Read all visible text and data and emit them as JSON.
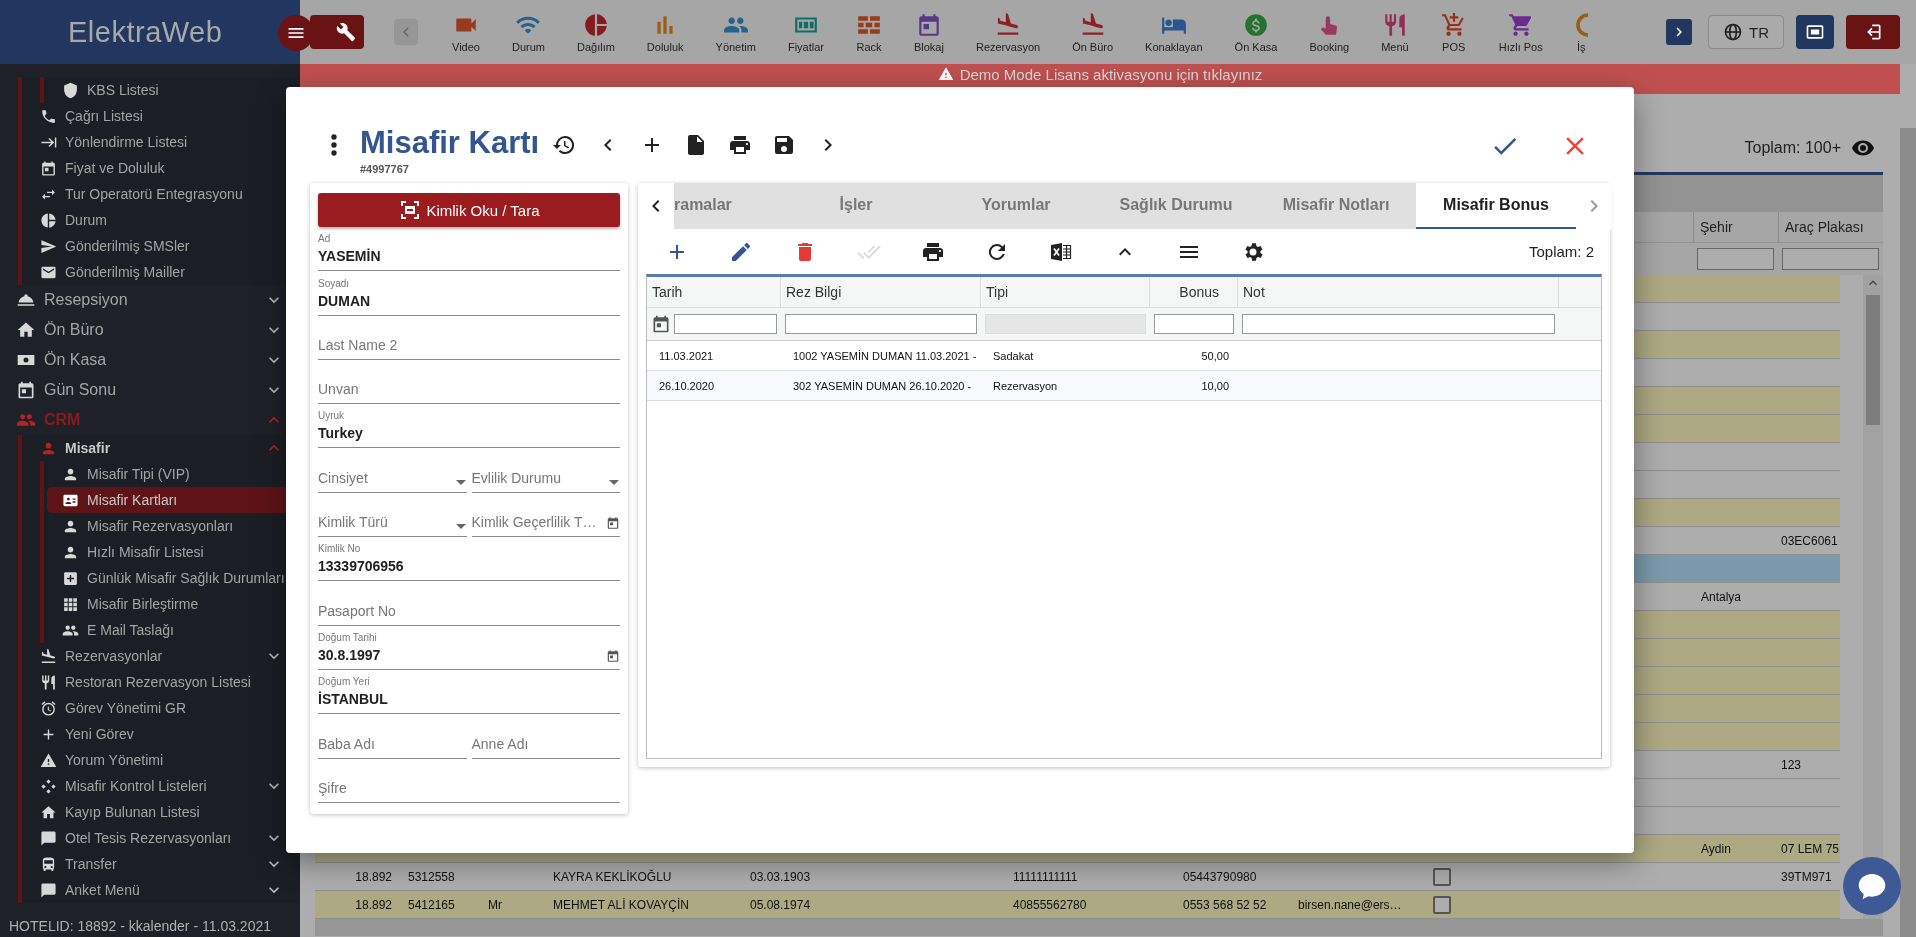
{
  "app_header": {
    "logo": "ElektraWeb",
    "language": "TR",
    "modules": [
      {
        "label": "Video",
        "color": "#983a1d"
      },
      {
        "label": "Durum",
        "color": "#27618d"
      },
      {
        "label": "Dağılım",
        "color": "#831b1f"
      },
      {
        "label": "Doluluk",
        "color": "#985e14"
      },
      {
        "label": "Yönetim",
        "color": "#27618d"
      },
      {
        "label": "Fiyatlar",
        "color": "#0e6d66"
      },
      {
        "label": "Rack",
        "color": "#983b1d"
      },
      {
        "label": "Blokaj",
        "color": "#563b84"
      },
      {
        "label": "Rezervasyon",
        "color": "#8f2020"
      },
      {
        "label": "Ön Büro",
        "color": "#8f2020"
      },
      {
        "label": "Konaklayan",
        "color": "#2b568d"
      },
      {
        "label": "Ön Kasa",
        "color": "#23722f"
      },
      {
        "label": "Booking",
        "color": "#983a5e"
      },
      {
        "label": "Menü",
        "color": "#932e53"
      },
      {
        "label": "POS",
        "color": "#982f1d"
      },
      {
        "label": "Hızlı Pos",
        "color": "#6a2b8d"
      },
      {
        "label": "İş",
        "color": "#985e14"
      }
    ]
  },
  "sidebar": {
    "items": [
      {
        "children": [
          {
            "children": [
              {
                "label": "KBS Listesi",
                "selected": false
              }
            ]
          },
          {
            "label": "Çağrı Listesi",
            "selected": false
          },
          {
            "label": "Yönlendirme Listesi",
            "selected": false
          },
          {
            "label": "Fiyat ve Doluluk",
            "selected": false
          },
          {
            "label": "Tur Operatorü Entegrasyonu",
            "selected": false
          },
          {
            "label": "Durum",
            "selected": false
          },
          {
            "label": "Gönderilmiş SMSler",
            "selected": false
          },
          {
            "label": "Gönderilmiş Mailler",
            "selected": false
          }
        ]
      },
      {
        "label": "Resepsiyon",
        "expanded": false,
        "selected": false
      },
      {
        "label": "Ön Büro",
        "expanded": false,
        "selected": false
      },
      {
        "label": "Ön Kasa",
        "expanded": false,
        "selected": false
      },
      {
        "label": "Gün Sonu",
        "expanded": false,
        "selected": false
      },
      {
        "label": "CRM",
        "expanded": true,
        "selected": false,
        "children": [
          {
            "label": "Misafir",
            "expanded": true,
            "selected": false,
            "children": [
              {
                "label": "Misafir Tipi (VIP)",
                "selected": false
              },
              {
                "label": "Misafir Kartları",
                "selected": true
              },
              {
                "label": "Misafir Rezervasyonları",
                "selected": false
              },
              {
                "label": "Hızlı Misafir Listesi",
                "selected": false
              },
              {
                "label": "Günlük Misafir Sağlık Durumları",
                "selected": false
              },
              {
                "label": "Misafir Birleştirme",
                "selected": false
              },
              {
                "label": "E Mail Taslağı",
                "selected": false
              }
            ]
          },
          {
            "label": "Rezervasyonlar",
            "expanded": false,
            "selected": false
          },
          {
            "label": "Restoran Rezervasyon Listesi",
            "selected": false
          },
          {
            "label": "Görev Yönetimi GR",
            "selected": false
          },
          {
            "label": "Yeni Görev",
            "selected": false
          },
          {
            "label": "Yorum Yönetimi",
            "selected": false
          },
          {
            "label": "Misafir Kontrol Listeleri",
            "expanded": false,
            "selected": false
          },
          {
            "label": "Kayıp Bulunan Listesi",
            "selected": false
          },
          {
            "label": "Otel Tesis Rezervasyonları",
            "expanded": false,
            "selected": false
          },
          {
            "label": "Transfer",
            "expanded": false,
            "selected": false
          },
          {
            "label": "Anket Menü",
            "expanded": false,
            "selected": false
          }
        ]
      }
    ],
    "footer": "HOTELID: 18892 - kkalender - 11.03.2021"
  },
  "demo_banner": "Demo Mode Lisans aktivasyonu için tıklayınız",
  "guest_table": {
    "total": "Toplam: 100+",
    "columns": {
      "sehir": "Şehir",
      "arac_plakasi": "Araç Plakası"
    },
    "rows": [
      {
        "color": "#aca983"
      },
      {
        "color": "#adadad"
      },
      {
        "color": "#aca983"
      },
      {
        "color": "#adadad"
      },
      {
        "color": "#aca983"
      },
      {
        "color": "#aca983"
      },
      {
        "color": "#adadad"
      },
      {
        "color": "#adadad"
      },
      {
        "color": "#aca983"
      },
      {
        "color": "#adadad",
        "arac_plakasi": "03EC6061"
      },
      {
        "color": "#7a9aab"
      },
      {
        "color": "#adadad",
        "sehir": "Antalya"
      },
      {
        "color": "#aca983"
      },
      {
        "color": "#aca983"
      },
      {
        "color": "#aca983"
      },
      {
        "color": "#aca983"
      },
      {
        "color": "#aca983"
      },
      {
        "color": "#adadad",
        "arac_plakasi": "123"
      },
      {
        "color": "#adadad"
      },
      {
        "color": "#adadad"
      },
      {
        "color": "#aca983",
        "sehir": "Aydin",
        "arac_plakasi": "07 LEM 75"
      },
      {
        "color": "#adadad",
        "checked": false,
        "column_1": "18.892",
        "column_2": "5312558",
        "column_4": "KAYRA KEKLİKOĞLU",
        "column_5": "03.03.1903",
        "column_7": "11111111111",
        "column_8": "05443790980",
        "arac_plakasi": "39TM971"
      },
      {
        "color": "#aca983",
        "checked": false,
        "column_1": "18.892",
        "column_2": "5412165",
        "column_3": "Mr",
        "column_4": "MEHMET ALİ KOVAYÇİN",
        "column_5": "05.08.1974",
        "column_7": "40855562780",
        "column_8": "0553 568 52 52",
        "column_9": "birsen.nane@ers…"
      }
    ]
  },
  "modal": {
    "title": "Misafir Kartı",
    "record_id": "#4997767",
    "scan_button": "Kimlik Oku / Tara",
    "form_rows": [
      {
        "fields": [
          {
            "kind": "text",
            "label": "Ad",
            "value": "YASEMİN"
          }
        ]
      },
      {
        "fields": [
          {
            "kind": "text",
            "label": "Soyadı",
            "value": "DUMAN"
          }
        ]
      },
      {
        "fields": [
          {
            "kind": "text",
            "placeholder": "Last Name 2"
          }
        ]
      },
      {
        "fields": [
          {
            "kind": "text",
            "placeholder": "Unvan"
          }
        ]
      },
      {
        "fields": [
          {
            "kind": "text",
            "label": "Uyruk",
            "value": "Turkey"
          }
        ]
      },
      {
        "fields": [
          {
            "kind": "select",
            "placeholder": "Cinsiyet"
          },
          {
            "kind": "select",
            "placeholder": "Evlilik Durumu"
          }
        ]
      },
      {
        "fields": [
          {
            "kind": "select",
            "placeholder": "Kimlik Türü"
          },
          {
            "kind": "date",
            "placeholder": "Kimlik Geçerlilik T…"
          }
        ]
      },
      {
        "fields": [
          {
            "kind": "text",
            "label": "Kimlik No",
            "value": "13339706956"
          }
        ]
      },
      {
        "fields": [
          {
            "kind": "text",
            "placeholder": "Pasaport No"
          }
        ]
      },
      {
        "fields": [
          {
            "kind": "date",
            "label": "Doğum Tarihi",
            "value": "30.8.1997"
          }
        ]
      },
      {
        "fields": [
          {
            "kind": "text",
            "label": "Doğum Yeri",
            "value": "İSTANBUL"
          }
        ]
      },
      {
        "fields": [
          {
            "kind": "text",
            "placeholder": "Baba Adı"
          },
          {
            "kind": "text",
            "placeholder": "Anne Adı"
          }
        ]
      },
      {
        "fields": [
          {
            "kind": "text",
            "placeholder": "Şifre"
          }
        ]
      }
    ],
    "tabs": [
      {
        "label": "ramalar",
        "selected": false
      },
      {
        "label": "İşler",
        "selected": false
      },
      {
        "label": "Yorumlar",
        "selected": false
      },
      {
        "label": "Sağlık Durumu",
        "selected": false
      },
      {
        "label": "Misafir Notları",
        "selected": false
      },
      {
        "label": "Misafir Bonus",
        "selected": true
      }
    ],
    "tools": [
      {
        "disabled": false
      },
      {
        "disabled": false
      },
      {
        "disabled": false
      },
      {
        "disabled": true
      },
      {
        "disabled": false
      },
      {
        "disabled": false
      },
      {
        "disabled": false
      },
      {
        "disabled": false
      },
      {
        "disabled": false
      },
      {
        "disabled": false
      }
    ],
    "total": "Toplam: 2",
    "grid": {
      "columns": [
        {
          "label": "Tarih",
          "kind": "date",
          "filter_disabled": false
        },
        {
          "label": "Rez Bilgi",
          "kind": "text",
          "filter_disabled": false
        },
        {
          "label": "Tipi",
          "kind": "text",
          "filter_disabled": true
        },
        {
          "label": "Bonus",
          "kind": "number",
          "filter_disabled": false
        },
        {
          "label": "Not",
          "kind": "text",
          "filter_disabled": false
        }
      ],
      "rows": [
        {
          "cells": [
            "11.03.2021",
            "1002 YASEMİN DUMAN 11.03.2021 -",
            "Sadakat",
            "50,00"
          ]
        },
        {
          "cells": [
            "26.10.2020",
            "302 YASEMİN DUMAN 26.10.2020 -",
            "Rezervasyon",
            "10,00"
          ]
        }
      ]
    }
  }
}
